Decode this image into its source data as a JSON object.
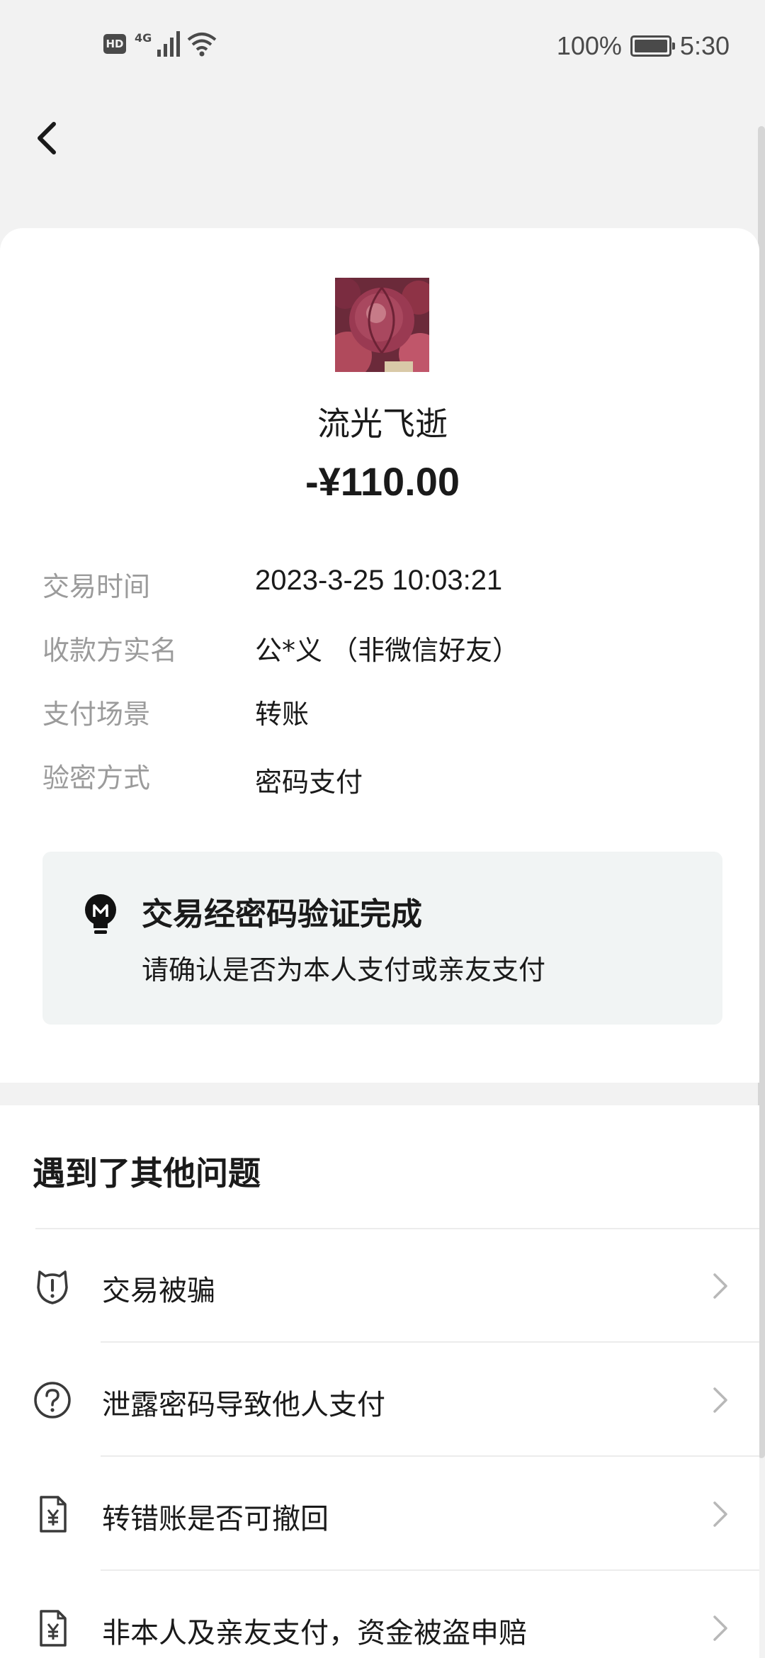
{
  "status_bar": {
    "hd_label": "HD",
    "network_label": "4G",
    "battery_percent": "100%",
    "time": "5:30"
  },
  "transaction": {
    "payee_name": "流光飞逝",
    "amount": "-¥110.00",
    "details": [
      {
        "label": "交易时间",
        "value": "2023-3-25 10:03:21"
      },
      {
        "label": "收款方实名",
        "value": "公*义 （非微信好友）"
      },
      {
        "label": "支付场景",
        "value": "转账"
      },
      {
        "label": "验密方式",
        "value": "密码支付"
      }
    ]
  },
  "notice": {
    "title": "交易经密码验证完成",
    "subtitle": "请确认是否为本人支付或亲友支付"
  },
  "problems": {
    "title": "遇到了其他问题",
    "items": [
      {
        "label": "交易被骗",
        "icon": "alert-shield-icon"
      },
      {
        "label": "泄露密码导致他人支付",
        "icon": "question-circle-icon"
      },
      {
        "label": "转错账是否可撤回",
        "icon": "yuan-document-icon"
      },
      {
        "label": "非本人及亲友支付，资金被盗申赔",
        "icon": "yuan-document-icon"
      }
    ]
  },
  "colors": {
    "background": "#f2f2f2",
    "card": "#ffffff",
    "label_gray": "#9b9b9b",
    "notice_bg": "#f1f4f4"
  }
}
